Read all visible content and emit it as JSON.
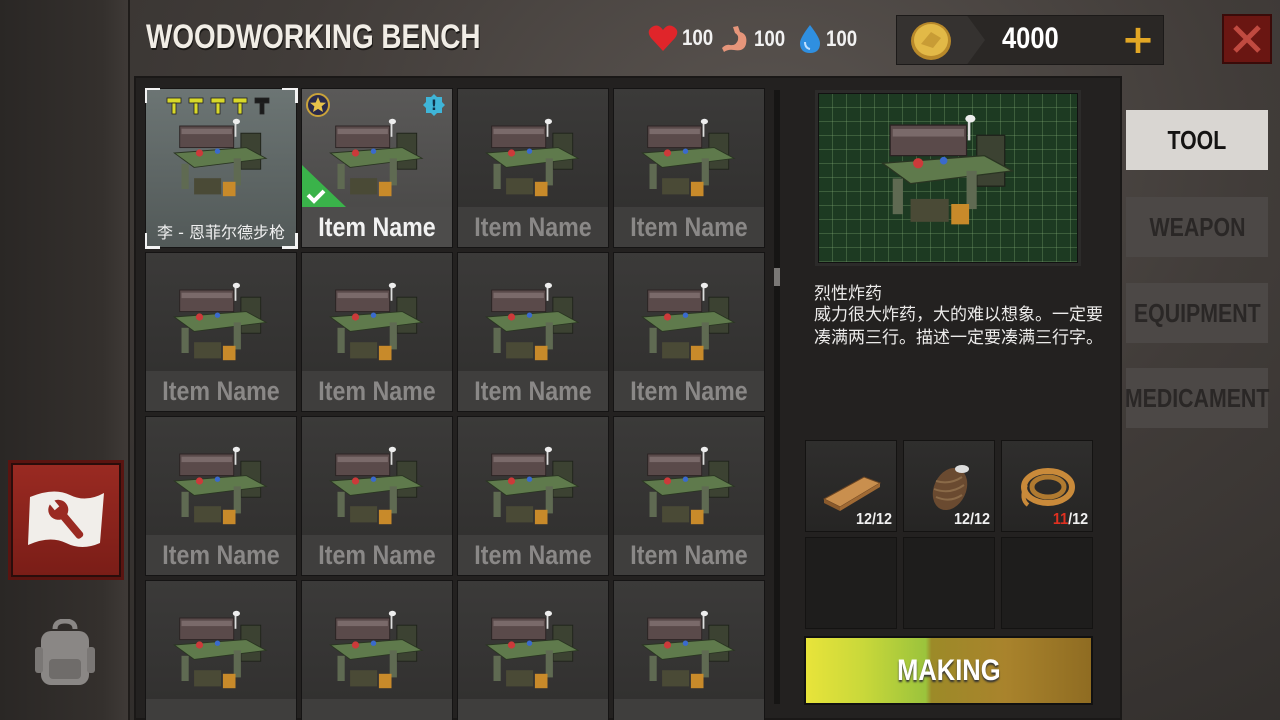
{
  "header": {
    "title": "WOODWORKING BENCH",
    "stats": [
      {
        "icon": "heart-icon",
        "value": "100",
        "color": "#e0252a"
      },
      {
        "icon": "stomach-icon",
        "value": "100",
        "color": "#e6957a"
      },
      {
        "icon": "water-drop-icon",
        "value": "100",
        "color": "#2f8fe0"
      }
    ],
    "coins": "4000",
    "plus_label": "+"
  },
  "grid": {
    "items": [
      {
        "name": "李 - 恩菲尔德步枪",
        "state": "selected",
        "hammers": 5
      },
      {
        "name": "Item Name",
        "state": "owned",
        "star": true,
        "alert": "!",
        "check": true
      },
      {
        "name": "Item Name",
        "state": "normal"
      },
      {
        "name": "Item Name",
        "state": "normal"
      },
      {
        "name": "Item Name",
        "state": "normal"
      },
      {
        "name": "Item Name",
        "state": "normal"
      },
      {
        "name": "Item Name",
        "state": "normal"
      },
      {
        "name": "Item Name",
        "state": "normal"
      },
      {
        "name": "Item Name",
        "state": "normal"
      },
      {
        "name": "Item Name",
        "state": "normal"
      },
      {
        "name": "Item Name",
        "state": "normal"
      },
      {
        "name": "Item Name",
        "state": "normal"
      },
      {
        "name": "",
        "state": "normal"
      },
      {
        "name": "",
        "state": "normal"
      },
      {
        "name": "",
        "state": "normal"
      },
      {
        "name": "",
        "state": "normal"
      }
    ]
  },
  "detail": {
    "title": "烈性炸药",
    "description": "威力很大炸药，大的难以想象。一定要凑满两三行。描述一定要凑满三行字。",
    "materials": [
      {
        "icon": "wood-plank-icon",
        "have": "12",
        "need": "/12",
        "short": false
      },
      {
        "icon": "thread-spool-icon",
        "have": "12",
        "need": "/12",
        "short": false
      },
      {
        "icon": "rope-coil-icon",
        "have": "11",
        "need": "/12",
        "short": true
      },
      {
        "icon": "",
        "have": "",
        "need": ""
      },
      {
        "icon": "",
        "have": "",
        "need": ""
      },
      {
        "icon": "",
        "have": "",
        "need": ""
      }
    ],
    "make_label": "MAKING"
  },
  "tabs": [
    "TOOL",
    "WEAPON",
    "EQUIPMENT",
    "MEDICAMENT"
  ],
  "active_tab": "TOOL"
}
